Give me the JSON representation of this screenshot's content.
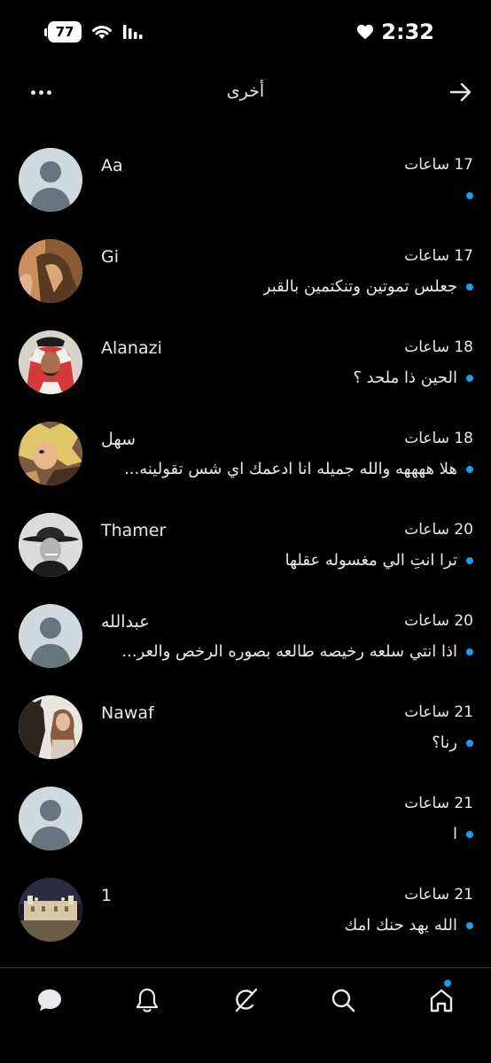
{
  "status_bar": {
    "battery": "77",
    "time": "2:32"
  },
  "header": {
    "title": "أخرى"
  },
  "conversations": [
    {
      "name": "Aa",
      "time": "17 ساعات",
      "message": "ٍ",
      "avatar": "default"
    },
    {
      "name": "Gi",
      "time": "17 ساعات",
      "message": "جعلس تموتين وتنكتمين بالقبر",
      "avatar": "photo-bronze"
    },
    {
      "name": "Alanazi",
      "time": "18 ساعات",
      "message": "الحين ذا ملحد ؟",
      "avatar": "photo-ghutra"
    },
    {
      "name": "سهل",
      "time": "18 ساعات",
      "message": "هلا ههههه والله جميله انا ادعمك اي شس تقولينه...",
      "avatar": "photo-anime"
    },
    {
      "name": "Thamer",
      "time": "20 ساعات",
      "message": "ترا انتِ الي مغسوله عقلها",
      "avatar": "photo-cowboy"
    },
    {
      "name": "عبدالله",
      "time": "20 ساعات",
      "message": "اذا انتي سلعه رخيصه طالعه بصوره الرخص والعر...",
      "avatar": "default"
    },
    {
      "name": "Nawaf",
      "time": "21 ساعات",
      "message": "رنا؟",
      "avatar": "photo-horse"
    },
    {
      "name": "",
      "time": "21 ساعات",
      "message": "ا",
      "avatar": "default"
    },
    {
      "name": "1",
      "time": "21 ساعات",
      "message": "الله يهد حنك امك",
      "avatar": "photo-city"
    }
  ],
  "colors": {
    "background": "#000000",
    "text": "#e7e9ea",
    "accent": "#1d9bf0",
    "divider": "#2f3336"
  },
  "tabbar": {
    "items": [
      "messages-icon",
      "notifications-icon",
      "grok-icon",
      "search-icon",
      "home-icon"
    ]
  }
}
